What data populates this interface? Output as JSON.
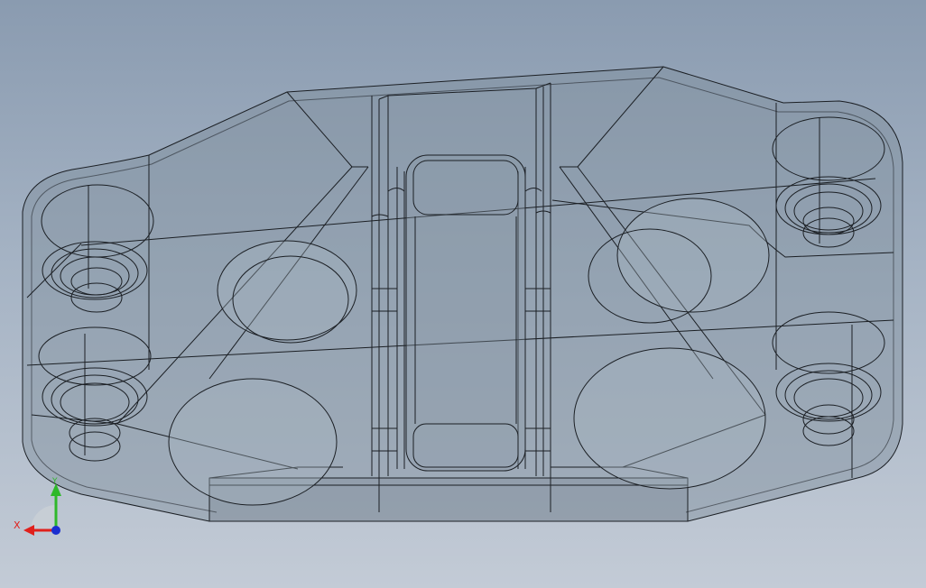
{
  "viewport": {
    "background_top": "#8a9bb0",
    "background_bottom": "#c3cbd6"
  },
  "model": {
    "description_icon": "translucent-bracket-part",
    "body_fill": "#7f8d9c",
    "edge_color": "#1b1f24"
  },
  "triad": {
    "x_label": "X",
    "y_label": "Y",
    "x_color": "#e0201c",
    "y_color": "#2fb82a",
    "z_color": "#1b2fd0"
  }
}
